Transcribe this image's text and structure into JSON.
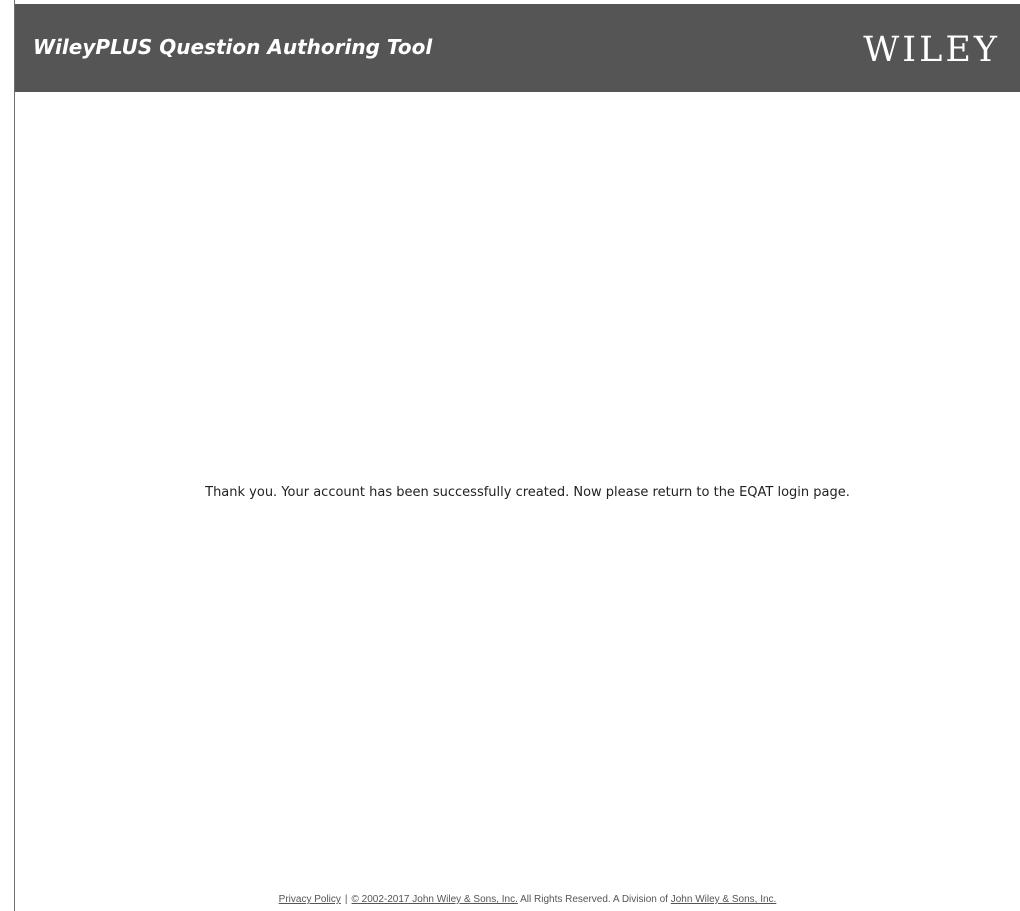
{
  "header": {
    "app_title": "WileyPLUS Question Authoring Tool",
    "brand_logo": "WILEY",
    "background": "#555555"
  },
  "main": {
    "message": "Thank you. Your account has been successfully created. Now please return to the EQAT login page."
  },
  "footer": {
    "privacy_link": "Privacy Policy",
    "separator": "|",
    "copyright_link": "© 2002-2017 John Wiley & Sons, Inc.",
    "rights_text": "All Rights Reserved. A Division of",
    "company_link": "John Wiley & Sons, Inc."
  }
}
